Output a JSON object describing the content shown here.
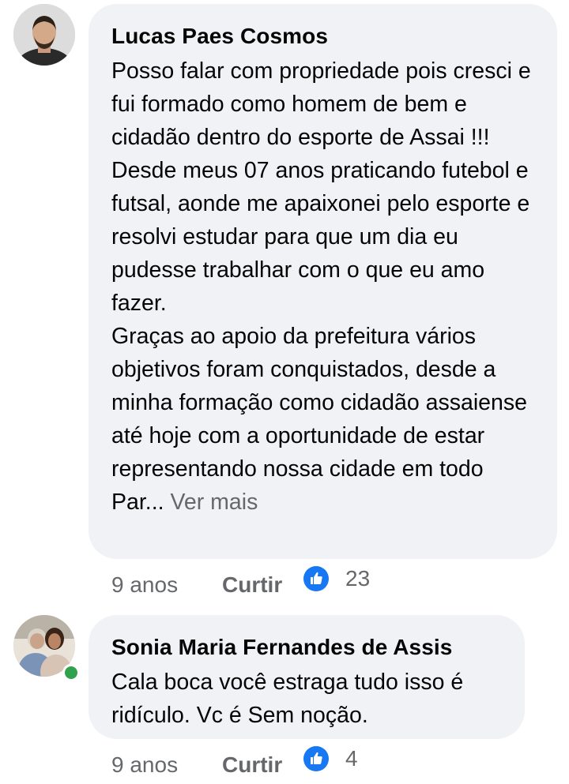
{
  "comments": [
    {
      "author": "Lucas Paes Cosmos",
      "paragraphs": [
        "Posso falar com propriedade pois cresci e fui formado como homem de bem e cidadão dentro do esporte de Assai !!!",
        "Desde meus 07 anos praticando futebol e futsal, aonde me apaixonei pelo esporte e resolvi estudar para que um dia eu pudesse trabalhar com o que eu amo fazer.",
        "Graças ao apoio da prefeitura vários objetivos foram conquistados, desde a minha formação como cidadão assaiense até hoje com a oportunidade de estar representando nossa cidade em todo Par"
      ],
      "ellipsis": "...",
      "see_more": "Ver mais",
      "time": "9 anos",
      "like_label": "Curtir",
      "reaction_icon": "like-icon",
      "reaction_count": "23",
      "online": false
    },
    {
      "author": "Sonia Maria Fernandes de Assis",
      "paragraphs": [
        "Cala boca você estraga tudo isso é ridículo. Vc é  Sem noção."
      ],
      "time": "9 anos",
      "like_label": "Curtir",
      "reaction_icon": "like-icon",
      "reaction_count": "4",
      "online": true
    }
  ],
  "colors": {
    "bubble": "#f0f2f5",
    "secondary_text": "#65676b",
    "like_blue": "#1877f2",
    "online_green": "#31a24c"
  }
}
